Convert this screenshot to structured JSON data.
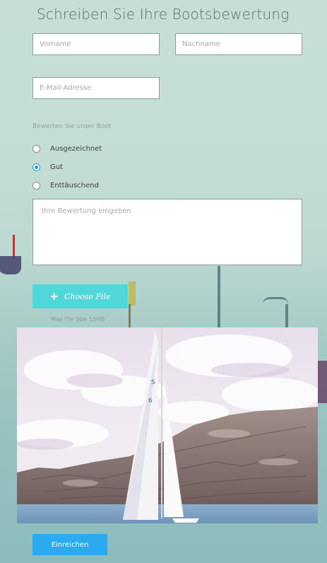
{
  "form": {
    "title": "Schreiben Sie Ihre Bootsbewertung",
    "first_name_placeholder": "Vorname",
    "last_name_placeholder": "Nachname",
    "email_placeholder": "E-Mail-Adresse",
    "rating_label": "Bewerten Sie unser Boot",
    "rating_options": [
      {
        "label": "Ausgezeichnet",
        "selected": false
      },
      {
        "label": "Gut",
        "selected": true
      },
      {
        "label": "Enttäuschend",
        "selected": false
      }
    ],
    "review_placeholder": "Ihre Bewertung eingeben",
    "upload_label": "Choose File",
    "upload_icon": "plus-icon",
    "max_file_size": "Max File Size 15MB",
    "submit_label": "Einreichen"
  },
  "colors": {
    "accent_upload": "#4fd7d9",
    "accent_submit": "#2aaaf0",
    "radio_selected": "#2e9ad0",
    "title_text": "#5f6b69"
  }
}
